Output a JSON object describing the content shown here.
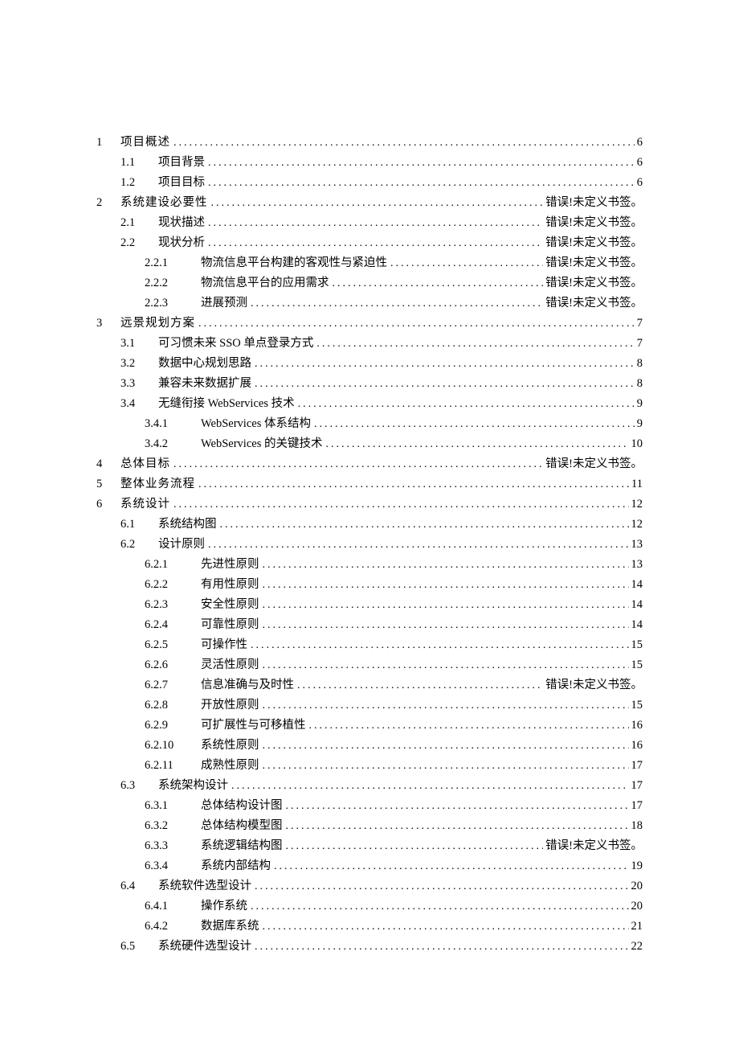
{
  "err": "错误!未定义书签。",
  "toc": [
    {
      "lvl": 1,
      "n": "1",
      "t": "项目概述",
      "p": "6"
    },
    {
      "lvl": 2,
      "n": "1.1",
      "t": "项目背景",
      "p": "6"
    },
    {
      "lvl": 2,
      "n": "1.2",
      "t": "项目目标",
      "p": "6"
    },
    {
      "lvl": 1,
      "n": "2",
      "t": "系统建设必要性",
      "p": "ERR"
    },
    {
      "lvl": 2,
      "n": "2.1",
      "t": "现状描述",
      "p": "ERR"
    },
    {
      "lvl": 2,
      "n": "2.2",
      "t": "现状分析",
      "p": "ERR"
    },
    {
      "lvl": 3,
      "n": "2.2.1",
      "t": "物流信息平台构建的客观性与紧迫性",
      "p": "ERR"
    },
    {
      "lvl": 3,
      "n": "2.2.2",
      "t": "物流信息平台的应用需求",
      "p": "ERR"
    },
    {
      "lvl": 3,
      "n": "2.2.3",
      "t": "进展预测",
      "p": "ERR"
    },
    {
      "lvl": 1,
      "n": "3",
      "t": "远景规划方案",
      "p": "7"
    },
    {
      "lvl": 2,
      "n": "3.1",
      "t": "可习惯未来 SSO 单点登录方式",
      "p": "7"
    },
    {
      "lvl": 2,
      "n": "3.2",
      "t": "数据中心规划思路",
      "p": "8"
    },
    {
      "lvl": 2,
      "n": "3.3",
      "t": "兼容未来数据扩展",
      "p": "8"
    },
    {
      "lvl": 2,
      "n": "3.4",
      "t": "无缝衔接 WebServices 技术",
      "p": "9"
    },
    {
      "lvl": 3,
      "n": "3.4.1",
      "t": "WebServices 体系结构",
      "p": "9"
    },
    {
      "lvl": 3,
      "n": "3.4.2",
      "t": "WebServices 的关键技术",
      "p": "10"
    },
    {
      "lvl": 1,
      "n": "4",
      "t": "总体目标",
      "p": "ERR"
    },
    {
      "lvl": 1,
      "n": "5",
      "t": "整体业务流程",
      "p": "11"
    },
    {
      "lvl": 1,
      "n": "6",
      "t": "系统设计",
      "p": "12"
    },
    {
      "lvl": 2,
      "n": "6.1",
      "t": "系统结构图",
      "p": "12"
    },
    {
      "lvl": 2,
      "n": "6.2",
      "t": "设计原则",
      "p": "13"
    },
    {
      "lvl": 3,
      "n": "6.2.1",
      "t": "先进性原则",
      "p": "13"
    },
    {
      "lvl": 3,
      "n": "6.2.2",
      "t": "有用性原则",
      "p": "14"
    },
    {
      "lvl": 3,
      "n": "6.2.3",
      "t": "安全性原则",
      "p": "14"
    },
    {
      "lvl": 3,
      "n": "6.2.4",
      "t": "可靠性原则",
      "p": "14"
    },
    {
      "lvl": 3,
      "n": "6.2.5",
      "t": "可操作性",
      "p": "15"
    },
    {
      "lvl": 3,
      "n": "6.2.6",
      "t": "灵活性原则",
      "p": "15"
    },
    {
      "lvl": 3,
      "n": "6.2.7",
      "t": "信息准确与及时性",
      "p": "ERR"
    },
    {
      "lvl": 3,
      "n": "6.2.8",
      "t": "开放性原则",
      "p": "15"
    },
    {
      "lvl": 3,
      "n": "6.2.9",
      "t": "可扩展性与可移植性",
      "p": "16"
    },
    {
      "lvl": 3,
      "n": "6.2.10",
      "t": "系统性原则",
      "p": "16"
    },
    {
      "lvl": 3,
      "n": "6.2.11",
      "t": "成熟性原则",
      "p": "17"
    },
    {
      "lvl": 2,
      "n": "6.3",
      "t": "系统架构设计",
      "p": "17"
    },
    {
      "lvl": 3,
      "n": "6.3.1",
      "t": "总体结构设计图",
      "p": "17"
    },
    {
      "lvl": 3,
      "n": "6.3.2",
      "t": "总体结构模型图",
      "p": "18"
    },
    {
      "lvl": 3,
      "n": "6.3.3",
      "t": "系统逻辑结构图",
      "p": "ERR"
    },
    {
      "lvl": 3,
      "n": "6.3.4",
      "t": "系统内部结构",
      "p": "19"
    },
    {
      "lvl": 2,
      "n": "6.4",
      "t": "系统软件选型设计",
      "p": "20"
    },
    {
      "lvl": 3,
      "n": "6.4.1",
      "t": "操作系统",
      "p": "20"
    },
    {
      "lvl": 3,
      "n": "6.4.2",
      "t": "数据库系统",
      "p": "21"
    },
    {
      "lvl": 2,
      "n": "6.5",
      "t": "系统硬件选型设计",
      "p": "22"
    }
  ]
}
